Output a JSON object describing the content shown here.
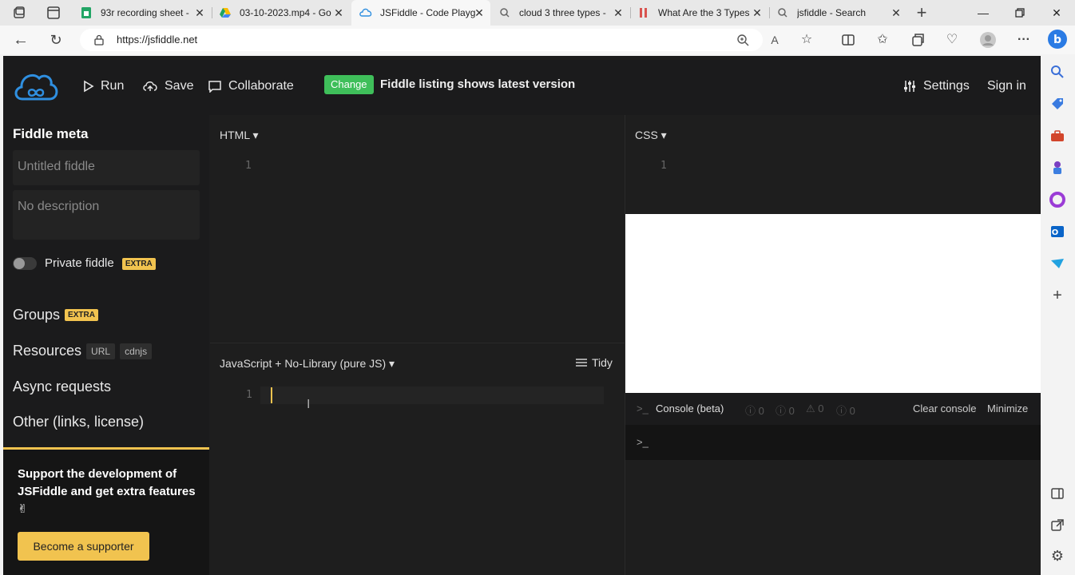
{
  "browser": {
    "tabs": [
      {
        "title": "93r recording sheet - ",
        "favicon": "sheets-icon"
      },
      {
        "title": "03-10-2023.mp4 - Go",
        "favicon": "drive-icon"
      },
      {
        "title": "JSFiddle - Code Playg",
        "favicon": "jsfiddle-icon",
        "active": true
      },
      {
        "title": "cloud 3 three types -",
        "favicon": "search-icon"
      },
      {
        "title": "What Are the 3 Types",
        "favicon": "site-icon"
      },
      {
        "title": "jsfiddle - Search",
        "favicon": "search-icon"
      }
    ],
    "url": "https://jsfiddle.net"
  },
  "header": {
    "run": "Run",
    "save": "Save",
    "collaborate": "Collaborate",
    "change": "Change",
    "listing_message": "Fiddle listing shows latest version",
    "settings": "Settings",
    "sign_in": "Sign in"
  },
  "sidebar": {
    "meta_title": "Fiddle meta",
    "title_placeholder": "Untitled fiddle",
    "description_placeholder": "No description",
    "private_label": "Private fiddle",
    "extra": "EXTRA",
    "groups": "Groups",
    "resources": "Resources",
    "url_chip": "URL",
    "cdnjs_chip": "cdnjs",
    "async": "Async requests",
    "other": "Other (links, license)",
    "support_text": "Support the development of JSFiddle and get extra features ✌",
    "support_button": "Become a supporter"
  },
  "editors": {
    "html_title": "HTML ▾",
    "css_title": "CSS ▾",
    "js_title": "JavaScript + No-Library (pure JS) ▾",
    "tidy": "Tidy",
    "line_one": "1"
  },
  "console": {
    "title": "Console (beta)",
    "info_count": "0",
    "log_count": "0",
    "warn_count": "0",
    "error_count": "0",
    "clear": "Clear console",
    "minimize": "Minimize",
    "prompt": ">_"
  },
  "colors": {
    "accent": "#f1c34f",
    "change_green": "#3fbf5a",
    "logo_blue": "#2f8fe0"
  }
}
